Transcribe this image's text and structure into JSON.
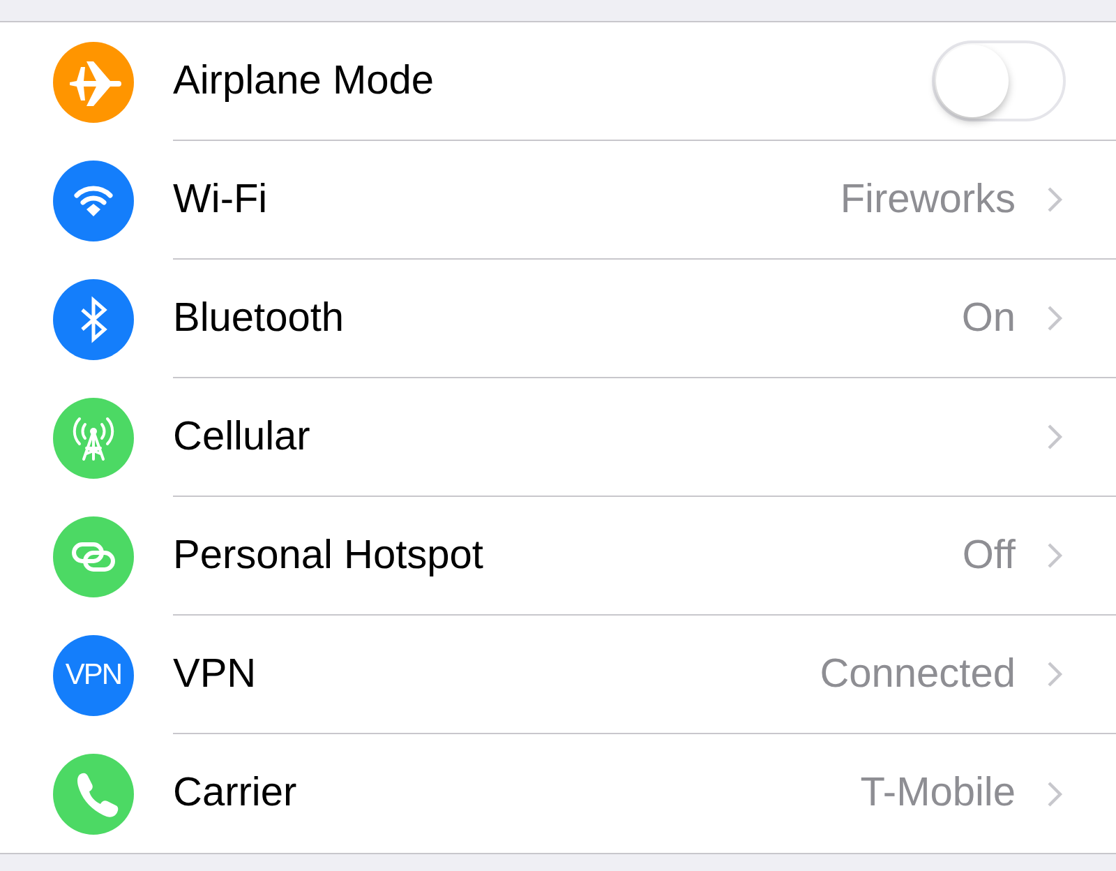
{
  "items": [
    {
      "kind": "toggle",
      "label": "Airplane Mode",
      "color": "#ff9500",
      "on": false
    },
    {
      "kind": "link",
      "label": "Wi-Fi",
      "color": "#147efb",
      "value": "Fireworks"
    },
    {
      "kind": "link",
      "label": "Bluetooth",
      "color": "#147efb",
      "value": "On"
    },
    {
      "kind": "link",
      "label": "Cellular",
      "color": "#4cd964"
    },
    {
      "kind": "link",
      "label": "Personal Hotspot",
      "color": "#4cd964",
      "value": "Off"
    },
    {
      "kind": "link",
      "label": "VPN",
      "color": "#147efb",
      "value": "Connected",
      "icon_text": "VPN"
    },
    {
      "kind": "link",
      "label": "Carrier",
      "color": "#4cd964",
      "value": "T-Mobile"
    }
  ]
}
